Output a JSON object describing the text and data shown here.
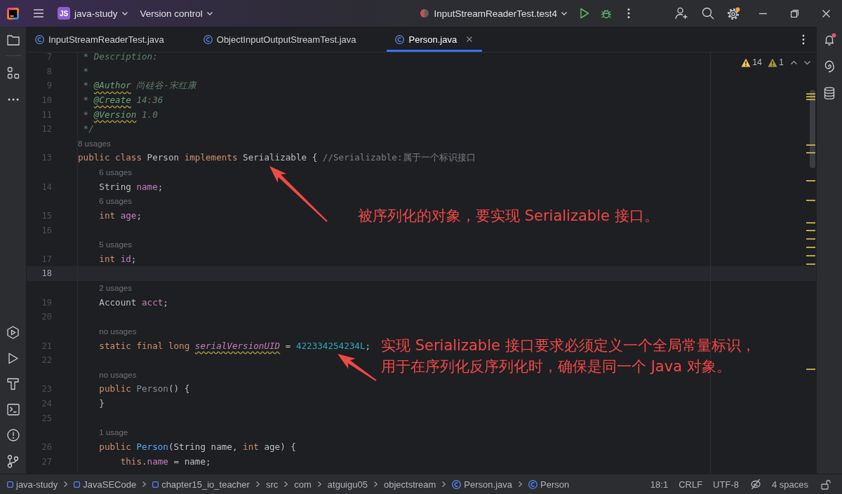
{
  "title_bar": {
    "project_badge": "JS",
    "project": "java-study",
    "vcs_menu": "Version control",
    "run_config": "InputStreamReaderTest.test4",
    "settings_update": true
  },
  "tool_windows": {
    "notifications_unread": true
  },
  "tabs": [
    {
      "label": "InputStreamReaderTest.java",
      "selected": false
    },
    {
      "label": "ObjectInputOutputStreamTest.java",
      "selected": false
    },
    {
      "label": "Person.java",
      "selected": true
    }
  ],
  "editor": {
    "inspections": {
      "warnings": "14",
      "weak_warnings": "1"
    },
    "lines": [
      {
        "number": "7",
        "current": false,
        "tokens": [
          {
            "kind": "doc",
            "text": " * Description:"
          }
        ]
      },
      {
        "number": "8",
        "current": false,
        "tokens": [
          {
            "kind": "doc",
            "text": " *"
          }
        ]
      },
      {
        "number": "9",
        "current": false,
        "tokens": [
          {
            "kind": "doc",
            "text": " * "
          },
          {
            "kind": "doc_tag",
            "text": "@Author"
          },
          {
            "kind": "doc",
            "text": " 尚硅谷-宋红康"
          }
        ]
      },
      {
        "number": "10",
        "current": false,
        "tokens": [
          {
            "kind": "doc",
            "text": " * "
          },
          {
            "kind": "doc_tag",
            "text": "@Create"
          },
          {
            "kind": "doc",
            "text": " 14:36"
          }
        ]
      },
      {
        "number": "11",
        "current": false,
        "tokens": [
          {
            "kind": "doc",
            "text": " * "
          },
          {
            "kind": "doc_tag",
            "text": "@Version"
          },
          {
            "kind": "doc",
            "text": " 1.0"
          }
        ]
      },
      {
        "number": "12",
        "current": false,
        "tokens": [
          {
            "kind": "doc",
            "text": " */"
          }
        ]
      },
      {
        "number": "13",
        "current": false,
        "usages": "8 usages",
        "tokens": [
          {
            "kind": "keyword",
            "text": "public class "
          },
          {
            "kind": "plain",
            "text": "Person "
          },
          {
            "kind": "keyword",
            "text": "implements "
          },
          {
            "kind": "plain",
            "text": "Serializable { "
          },
          {
            "kind": "comment",
            "text": "//Serializable:属于一个标识接口"
          }
        ]
      },
      {
        "number": "14",
        "current": false,
        "usages": "6 usages",
        "tokens": [
          {
            "kind": "plain",
            "text": "    String "
          },
          {
            "kind": "field",
            "text": "name"
          },
          {
            "kind": "plain",
            "text": ";"
          }
        ]
      },
      {
        "number": "15",
        "current": false,
        "usages": "6 usages",
        "tokens": [
          {
            "kind": "keyword",
            "text": "    int "
          },
          {
            "kind": "field",
            "text": "age"
          },
          {
            "kind": "plain",
            "text": ";"
          }
        ]
      },
      {
        "number": "16",
        "current": false
      },
      {
        "number": "17",
        "current": false,
        "usages": "5 usages",
        "tokens": [
          {
            "kind": "keyword",
            "text": "    int "
          },
          {
            "kind": "field",
            "text": "id"
          },
          {
            "kind": "plain",
            "text": ";"
          }
        ]
      },
      {
        "number": "18",
        "current": true
      },
      {
        "number": "19",
        "current": false,
        "usages": "2 usages",
        "tokens": [
          {
            "kind": "plain",
            "text": "    Account "
          },
          {
            "kind": "field",
            "text": "acct"
          },
          {
            "kind": "plain",
            "text": ";"
          }
        ]
      },
      {
        "number": "20",
        "current": false
      },
      {
        "number": "21",
        "current": false,
        "usages": "no usages",
        "tokens": [
          {
            "kind": "keyword",
            "text": "    static final long "
          },
          {
            "kind": "static_field",
            "text": "serialVersionUID"
          },
          {
            "kind": "plain",
            "text": " = "
          },
          {
            "kind": "number",
            "text": "422334254234L"
          },
          {
            "kind": "plain",
            "text": ";"
          }
        ]
      },
      {
        "number": "22",
        "current": false
      },
      {
        "number": "23",
        "current": false,
        "usages": "no usages",
        "tokens": [
          {
            "kind": "keyword",
            "text": "    public "
          },
          {
            "kind": "unused",
            "text": "Person"
          },
          {
            "kind": "plain",
            "text": "() {"
          }
        ]
      },
      {
        "number": "24",
        "current": false,
        "tokens": [
          {
            "kind": "plain",
            "text": "    }"
          }
        ]
      },
      {
        "number": "25",
        "current": false
      },
      {
        "number": "26",
        "current": false,
        "usages": "1 usage",
        "tokens": [
          {
            "kind": "keyword",
            "text": "    public "
          },
          {
            "kind": "method",
            "text": "Person"
          },
          {
            "kind": "plain",
            "text": "(String name, "
          },
          {
            "kind": "keyword",
            "text": "int"
          },
          {
            "kind": "plain",
            "text": " age) {"
          }
        ]
      },
      {
        "number": "27",
        "current": false,
        "tokens": [
          {
            "kind": "keyword",
            "text": "        this"
          },
          {
            "kind": "plain",
            "text": "."
          },
          {
            "kind": "field",
            "text": "name"
          },
          {
            "kind": "plain",
            "text": " = name;"
          }
        ]
      }
    ]
  },
  "annotations": [
    {
      "lines": [
        "被序列化的对象，要实现 Serializable 接口。"
      ]
    },
    {
      "lines": [
        "实现 Serializable 接口要求必须定义一个全局常量标识，",
        "用于在序列化反序列化时，确保是同一个 Java 对象。"
      ]
    }
  ],
  "status_bar": {
    "breadcrumbs": [
      {
        "label": "java-study",
        "kind": "module"
      },
      {
        "label": "JavaSECode",
        "kind": "module"
      },
      {
        "label": "chapter15_io_teacher",
        "kind": "module"
      },
      {
        "label": "src",
        "kind": "package"
      },
      {
        "label": "com",
        "kind": "package"
      },
      {
        "label": "atguigu05",
        "kind": "package"
      },
      {
        "label": "objectstream",
        "kind": "package"
      },
      {
        "label": "Person.java",
        "kind": "class"
      },
      {
        "label": "Person",
        "kind": "class"
      }
    ],
    "position": "18:1",
    "line_separator": "CRLF",
    "encoding": "UTF-8",
    "indent": "4 spaces",
    "locked": false
  }
}
